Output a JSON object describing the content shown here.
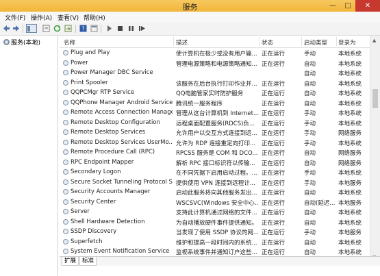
{
  "window": {
    "title": "服务",
    "min": "—",
    "max": "□",
    "close": "✕"
  },
  "menu": [
    "文件(F)",
    "操作(A)",
    "查看(V)",
    "帮助(H)"
  ],
  "left_pane": {
    "node": "服务(本地)"
  },
  "columns": {
    "name": "名称",
    "desc": "描述",
    "status": "状态",
    "startup": "启动类型",
    "logon": "登录为"
  },
  "services": [
    {
      "name": "Plug and Play",
      "desc": "使计算机在极少或没有用户输...",
      "status": "正在运行",
      "startup": "手动",
      "logon": "本地系统"
    },
    {
      "name": "Power",
      "desc": "管理电源策略和电源策略通知...",
      "status": "正在运行",
      "startup": "自动",
      "logon": "本地系统"
    },
    {
      "name": "Power Manager DBC Service",
      "desc": "",
      "status": "",
      "startup": "自动",
      "logon": "本地系统"
    },
    {
      "name": "Print Spooler",
      "desc": "该服务在后台执行打印作业并...",
      "status": "正在运行",
      "startup": "自动",
      "logon": "本地系统"
    },
    {
      "name": "QQPCMgr RTP Service",
      "desc": "QQ电脑管家实时防护服务",
      "status": "正在运行",
      "startup": "自动",
      "logon": "本地系统"
    },
    {
      "name": "QQPhone Manager Android Service",
      "desc": "腾讯统一服务程序",
      "status": "正在运行",
      "startup": "自动",
      "logon": "本地系统"
    },
    {
      "name": "Remote Access Connection Manager",
      "desc": "管理从这台计算机到 Internet...",
      "status": "正在运行",
      "startup": "手动",
      "logon": "本地系统"
    },
    {
      "name": "Remote Desktop Configuration",
      "desc": "远程桌面配置服务(RDCS)负...",
      "status": "正在运行",
      "startup": "手动",
      "logon": "本地系统"
    },
    {
      "name": "Remote Desktop Services",
      "desc": "允许用户以交互方式连接到远...",
      "status": "正在运行",
      "startup": "手动",
      "logon": "网络服务"
    },
    {
      "name": "Remote Desktop Services UserMo...",
      "desc": "允许为 RDP 连接重定向打印...",
      "status": "正在运行",
      "startup": "手动",
      "logon": "本地系统"
    },
    {
      "name": "Remote Procedure Call (RPC)",
      "desc": "RPCSS 服务是 COM 和 DCO...",
      "status": "正在运行",
      "startup": "自动",
      "logon": "网络服务"
    },
    {
      "name": "RPC Endpoint Mapper",
      "desc": "解析 RPC 接口标识符以传输...",
      "status": "正在运行",
      "startup": "自动",
      "logon": "网络服务"
    },
    {
      "name": "Secondary Logon",
      "desc": "在不同凭据下启用启动过程。...",
      "status": "正在运行",
      "startup": "手动",
      "logon": "本地系统"
    },
    {
      "name": "Secure Socket Tunneling Protocol S...",
      "desc": "提供使用 VPN 连接到远程计...",
      "status": "正在运行",
      "startup": "手动",
      "logon": "本地服务"
    },
    {
      "name": "Security Accounts Manager",
      "desc": "启动此服务将向其他服务发出...",
      "status": "正在运行",
      "startup": "自动",
      "logon": "本地系统"
    },
    {
      "name": "Security Center",
      "desc": "WSCSVC(Windows 安全中心...",
      "status": "正在运行",
      "startup": "自动(延迟...",
      "logon": "本地服务"
    },
    {
      "name": "Server",
      "desc": "支持此计算机通过网络的文件...",
      "status": "正在运行",
      "startup": "自动",
      "logon": "本地系统"
    },
    {
      "name": "Shell Hardware Detection",
      "desc": "为自动播放硬件事件提供通知。",
      "status": "正在运行",
      "startup": "自动",
      "logon": "本地系统"
    },
    {
      "name": "SSDP Discovery",
      "desc": "当发现了使用 SSDP 协议的网...",
      "status": "正在运行",
      "startup": "手动",
      "logon": "本地服务"
    },
    {
      "name": "Superfetch",
      "desc": "维护和提高一段时间内的系统...",
      "status": "正在运行",
      "startup": "自动",
      "logon": "本地系统"
    },
    {
      "name": "System Event Notification Service",
      "desc": "监视系统事件并通知订户这些...",
      "status": "正在运行",
      "startup": "自动",
      "logon": "本地系统"
    }
  ],
  "tabs": [
    "扩展",
    "标准"
  ]
}
